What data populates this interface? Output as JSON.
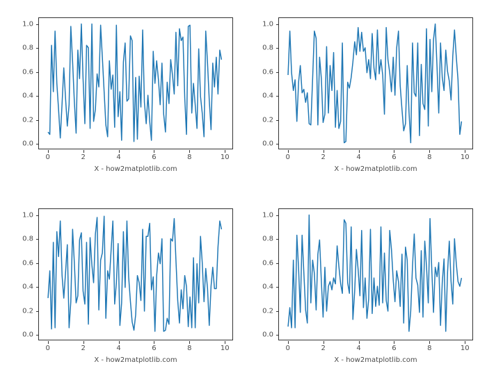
{
  "chart_data": [
    {
      "type": "line",
      "xlabel": "X - how2matplotlib.com",
      "ylabel": "",
      "title": "",
      "xlim": [
        -0.5,
        10.5
      ],
      "ylim": [
        -0.05,
        1.05
      ],
      "xticks": [
        0,
        2,
        4,
        6,
        8,
        10
      ],
      "yticks": [
        "0.0",
        "0.2",
        "0.4",
        "0.6",
        "0.8",
        "1.0"
      ],
      "x": [
        0,
        0.1,
        0.2,
        0.3,
        0.4,
        0.5,
        0.6,
        0.7,
        0.8,
        0.9,
        1,
        1.1,
        1.2,
        1.3,
        1.4,
        1.5,
        1.6,
        1.7,
        1.8,
        1.9,
        2,
        2.1,
        2.2,
        2.3,
        2.4,
        2.5,
        2.6,
        2.7,
        2.8,
        2.9,
        3,
        3.1,
        3.2,
        3.3,
        3.4,
        3.5,
        3.6,
        3.7,
        3.8,
        3.9,
        4,
        4.1,
        4.2,
        4.3,
        4.4,
        4.5,
        4.6,
        4.7,
        4.8,
        4.9,
        5,
        5.1,
        5.2,
        5.3,
        5.4,
        5.5,
        5.6,
        5.7,
        5.8,
        5.9,
        6,
        6.1,
        6.2,
        6.3,
        6.4,
        6.5,
        6.6,
        6.7,
        6.8,
        6.9,
        7,
        7.1,
        7.2,
        7.3,
        7.4,
        7.5,
        7.6,
        7.7,
        7.8,
        7.9,
        8,
        8.1,
        8.2,
        8.3,
        8.4,
        8.5,
        8.6,
        8.7,
        8.8,
        8.9,
        9,
        9.1,
        9.2,
        9.3,
        9.4,
        9.5,
        9.6,
        9.7,
        9.8,
        9.9
      ],
      "y": [
        0.09,
        0.07,
        0.82,
        0.43,
        0.94,
        0.5,
        0.28,
        0.04,
        0.33,
        0.63,
        0.37,
        0.14,
        0.32,
        0.98,
        0.68,
        0.35,
        0.08,
        0.78,
        0.54,
        1.0,
        0.54,
        0.16,
        0.82,
        0.8,
        0.12,
        1.0,
        0.18,
        0.28,
        0.58,
        0.47,
        0.99,
        0.72,
        0.43,
        0.15,
        0.05,
        0.69,
        0.45,
        0.57,
        0.13,
        0.99,
        0.22,
        0.43,
        0.02,
        0.68,
        0.84,
        0.35,
        0.37,
        0.9,
        0.86,
        0.01,
        0.55,
        0.03,
        0.56,
        0.3,
        0.95,
        0.34,
        0.16,
        0.4,
        0.18,
        0.02,
        0.77,
        0.5,
        0.69,
        0.53,
        0.32,
        0.67,
        0.24,
        0.09,
        0.51,
        0.33,
        0.7,
        0.57,
        0.41,
        0.93,
        0.48,
        0.96,
        0.86,
        0.89,
        0.38,
        0.07,
        0.98,
        0.99,
        0.25,
        0.5,
        0.32,
        0.12,
        0.79,
        0.39,
        0.25,
        0.05,
        0.94,
        0.67,
        0.36,
        0.11,
        0.67,
        0.47,
        0.72,
        0.41,
        0.78,
        0.7
      ]
    },
    {
      "type": "line",
      "xlabel": "X - how2matplotlib.com",
      "ylabel": "",
      "title": "",
      "xlim": [
        -0.5,
        10.5
      ],
      "ylim": [
        -0.05,
        1.05
      ],
      "xticks": [
        0,
        2,
        4,
        6,
        8,
        10
      ],
      "yticks": [
        "0.0",
        "0.2",
        "0.4",
        "0.6",
        "0.8",
        "1.0"
      ],
      "x": [
        0,
        0.1,
        0.2,
        0.3,
        0.4,
        0.5,
        0.6,
        0.7,
        0.8,
        0.9,
        1,
        1.1,
        1.2,
        1.3,
        1.4,
        1.5,
        1.6,
        1.7,
        1.8,
        1.9,
        2,
        2.1,
        2.2,
        2.3,
        2.4,
        2.5,
        2.6,
        2.7,
        2.8,
        2.9,
        3,
        3.1,
        3.2,
        3.3,
        3.4,
        3.5,
        3.6,
        3.7,
        3.8,
        3.9,
        4,
        4.1,
        4.2,
        4.3,
        4.4,
        4.5,
        4.6,
        4.7,
        4.8,
        4.9,
        5,
        5.1,
        5.2,
        5.3,
        5.4,
        5.5,
        5.6,
        5.7,
        5.8,
        5.9,
        6,
        6.1,
        6.2,
        6.3,
        6.4,
        6.5,
        6.6,
        6.7,
        6.8,
        6.9,
        7,
        7.1,
        7.2,
        7.3,
        7.4,
        7.5,
        7.6,
        7.7,
        7.8,
        7.9,
        8,
        8.1,
        8.2,
        8.3,
        8.4,
        8.5,
        8.6,
        8.7,
        8.8,
        8.9,
        9,
        9.1,
        9.2,
        9.3,
        9.4,
        9.5,
        9.6,
        9.7,
        9.8,
        9.9
      ],
      "y": [
        0.57,
        0.94,
        0.59,
        0.44,
        0.53,
        0.18,
        0.51,
        0.65,
        0.42,
        0.45,
        0.34,
        0.42,
        0.16,
        0.15,
        0.54,
        0.94,
        0.88,
        0.15,
        0.72,
        0.54,
        0.17,
        0.24,
        0.81,
        0.25,
        0.65,
        0.44,
        0.76,
        0.13,
        0.44,
        0.12,
        0.18,
        0.84,
        0.0,
        0.01,
        0.51,
        0.46,
        0.55,
        0.68,
        0.85,
        0.74,
        0.97,
        0.77,
        0.93,
        0.77,
        0.8,
        0.59,
        0.7,
        0.54,
        0.92,
        0.63,
        0.53,
        0.95,
        0.58,
        0.7,
        0.57,
        0.24,
        0.97,
        0.7,
        0.59,
        0.43,
        0.72,
        0.4,
        0.8,
        0.94,
        0.48,
        0.28,
        0.1,
        0.16,
        0.65,
        0.26,
        0.0,
        0.84,
        0.42,
        0.39,
        0.84,
        0.06,
        0.66,
        0.33,
        0.28,
        0.96,
        0.14,
        0.87,
        0.43,
        0.87,
        1.0,
        0.64,
        0.25,
        0.84,
        0.55,
        0.44,
        0.78,
        0.6,
        0.52,
        0.36,
        0.73,
        0.95,
        0.72,
        0.53,
        0.07,
        0.18
      ]
    },
    {
      "type": "line",
      "xlabel": "X - how2matplotlib.com",
      "ylabel": "",
      "title": "",
      "xlim": [
        -0.5,
        10.5
      ],
      "ylim": [
        -0.05,
        1.05
      ],
      "xticks": [
        0,
        2,
        4,
        6,
        8,
        10
      ],
      "yticks": [
        "0.0",
        "0.2",
        "0.4",
        "0.6",
        "0.8",
        "1.0"
      ],
      "x": [
        0,
        0.1,
        0.2,
        0.3,
        0.4,
        0.5,
        0.6,
        0.7,
        0.8,
        0.9,
        1,
        1.1,
        1.2,
        1.3,
        1.4,
        1.5,
        1.6,
        1.7,
        1.8,
        1.9,
        2,
        2.1,
        2.2,
        2.3,
        2.4,
        2.5,
        2.6,
        2.7,
        2.8,
        2.9,
        3,
        3.1,
        3.2,
        3.3,
        3.4,
        3.5,
        3.6,
        3.7,
        3.8,
        3.9,
        4,
        4.1,
        4.2,
        4.3,
        4.4,
        4.5,
        4.6,
        4.7,
        4.8,
        4.9,
        5,
        5.1,
        5.2,
        5.3,
        5.4,
        5.5,
        5.6,
        5.7,
        5.8,
        5.9,
        6,
        6.1,
        6.2,
        6.3,
        6.4,
        6.5,
        6.6,
        6.7,
        6.8,
        6.9,
        7,
        7.1,
        7.2,
        7.3,
        7.4,
        7.5,
        7.6,
        7.7,
        7.8,
        7.9,
        8,
        8.1,
        8.2,
        8.3,
        8.4,
        8.5,
        8.6,
        8.7,
        8.8,
        8.9,
        9,
        9.1,
        9.2,
        9.3,
        9.4,
        9.5,
        9.6,
        9.7,
        9.8,
        9.9
      ],
      "y": [
        0.3,
        0.53,
        0.04,
        0.77,
        0.05,
        0.86,
        0.65,
        0.95,
        0.49,
        0.3,
        0.52,
        0.75,
        0.05,
        0.27,
        0.88,
        0.6,
        0.26,
        0.32,
        0.79,
        0.85,
        0.36,
        0.25,
        0.77,
        0.08,
        0.81,
        0.58,
        0.43,
        0.84,
        0.98,
        0.2,
        0.62,
        0.68,
        0.99,
        0.13,
        0.53,
        0.46,
        0.71,
        0.95,
        0.25,
        0.43,
        0.76,
        0.07,
        0.26,
        0.86,
        0.39,
        0.95,
        0.48,
        0.27,
        0.1,
        0.03,
        0.16,
        0.49,
        0.43,
        0.28,
        0.88,
        0.19,
        0.82,
        0.82,
        0.93,
        0.37,
        0.48,
        0.02,
        0.49,
        0.68,
        0.59,
        0.8,
        0.02,
        0.03,
        0.13,
        0.08,
        0.8,
        0.78,
        0.97,
        0.62,
        0.28,
        0.09,
        0.37,
        0.21,
        0.49,
        0.4,
        0.06,
        0.31,
        0.05,
        0.64,
        0.05,
        0.59,
        0.26,
        0.82,
        0.6,
        0.27,
        0.55,
        0.38,
        0.07,
        0.4,
        0.56,
        0.38,
        0.38,
        0.73,
        0.95,
        0.88
      ]
    },
    {
      "type": "line",
      "xlabel": "X - how2matplotlib.com",
      "ylabel": "",
      "title": "",
      "xlim": [
        -0.5,
        10.5
      ],
      "ylim": [
        -0.05,
        1.05
      ],
      "xticks": [
        0,
        2,
        4,
        6,
        8,
        10
      ],
      "yticks": [
        "0.0",
        "0.2",
        "0.4",
        "0.6",
        "0.8",
        "1.0"
      ],
      "x": [
        0,
        0.1,
        0.2,
        0.3,
        0.4,
        0.5,
        0.6,
        0.7,
        0.8,
        0.9,
        1,
        1.1,
        1.2,
        1.3,
        1.4,
        1.5,
        1.6,
        1.7,
        1.8,
        1.9,
        2,
        2.1,
        2.2,
        2.3,
        2.4,
        2.5,
        2.6,
        2.7,
        2.8,
        2.9,
        3,
        3.1,
        3.2,
        3.3,
        3.4,
        3.5,
        3.6,
        3.7,
        3.8,
        3.9,
        4,
        4.1,
        4.2,
        4.3,
        4.4,
        4.5,
        4.6,
        4.7,
        4.8,
        4.9,
        5,
        5.1,
        5.2,
        5.3,
        5.4,
        5.5,
        5.6,
        5.7,
        5.8,
        5.9,
        6,
        6.1,
        6.2,
        6.3,
        6.4,
        6.5,
        6.6,
        6.7,
        6.8,
        6.9,
        7,
        7.1,
        7.2,
        7.3,
        7.4,
        7.5,
        7.6,
        7.7,
        7.8,
        7.9,
        8,
        8.1,
        8.2,
        8.3,
        8.4,
        8.5,
        8.6,
        8.7,
        8.8,
        8.9,
        9,
        9.1,
        9.2,
        9.3,
        9.4,
        9.5,
        9.6,
        9.7,
        9.8,
        9.9
      ],
      "y": [
        0.06,
        0.22,
        0.05,
        0.62,
        0.05,
        0.83,
        0.55,
        0.18,
        0.83,
        0.52,
        0.2,
        0.09,
        1.0,
        0.26,
        0.62,
        0.51,
        0.2,
        0.67,
        0.79,
        0.44,
        0.14,
        0.56,
        0.19,
        0.4,
        0.44,
        0.37,
        0.47,
        0.42,
        0.74,
        0.57,
        0.42,
        0.34,
        0.96,
        0.93,
        0.43,
        0.34,
        0.9,
        0.12,
        0.36,
        0.71,
        0.54,
        0.32,
        0.87,
        0.22,
        0.47,
        0.13,
        0.29,
        0.88,
        0.17,
        0.47,
        0.23,
        0.4,
        0.24,
        0.9,
        0.26,
        0.68,
        0.28,
        0.19,
        0.87,
        0.71,
        0.45,
        0.27,
        0.53,
        0.44,
        0.23,
        0.67,
        0.09,
        0.73,
        0.62,
        0.02,
        0.19,
        0.57,
        0.84,
        0.47,
        0.41,
        0.18,
        0.7,
        0.14,
        0.78,
        0.57,
        0.26,
        0.97,
        0.54,
        0.18,
        0.56,
        0.48,
        0.6,
        0.07,
        0.43,
        0.63,
        0.02,
        0.52,
        0.78,
        0.44,
        0.25,
        0.8,
        0.59,
        0.44,
        0.4,
        0.47
      ]
    }
  ]
}
